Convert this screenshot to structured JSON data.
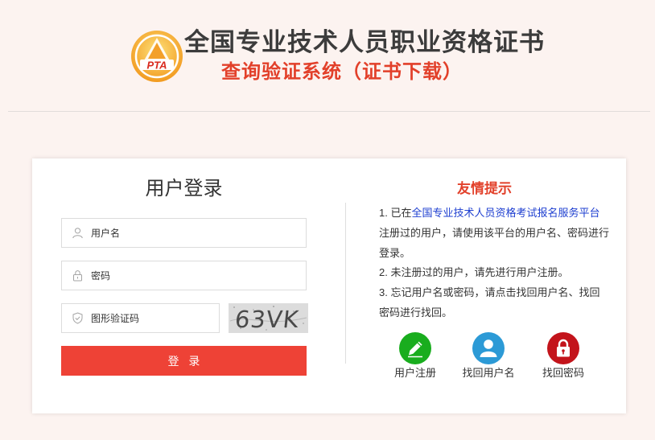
{
  "colors": {
    "page_bg": "#fcf3f0",
    "title": "#3c3c3c",
    "accent_red": "#e2402a",
    "button": "#ee4236",
    "link": "#1e3fd0"
  },
  "header": {
    "logo_text": "PTA",
    "title": "全国专业技术人员职业资格证书",
    "subtitle": "查询验证系统（证书下载）"
  },
  "login": {
    "title": "用户登录",
    "username": {
      "placeholder": "用户名",
      "value": "",
      "icon": "user-icon"
    },
    "password": {
      "placeholder": "密码",
      "value": "",
      "icon": "lock-icon"
    },
    "captcha": {
      "placeholder": "图形验证码",
      "value": "",
      "icon": "shield-check-icon",
      "image_text": "63VK"
    },
    "submit_label": "登 录"
  },
  "tips": {
    "title": "友情提示",
    "item1": {
      "prefix": "1. 已在",
      "link": "全国专业技术人员资格考试报名服务平台",
      "line2": "注册过的用户，请使用该平台的用户名、密码进行",
      "line3": "登录。"
    },
    "item2": {
      "line1": "2. 未注册过的用户，请先进行用户注册。"
    },
    "item3": {
      "line1": "3. 忘记用户名或密码，请点击找回用户名、找回",
      "line2": "密码进行找回。"
    }
  },
  "quick_links": [
    {
      "label": "用户注册",
      "icon": "pencil-icon",
      "color": "#19ad1e"
    },
    {
      "label": "找回用户名",
      "icon": "user-icon",
      "color": "#2c9ad6"
    },
    {
      "label": "找回密码",
      "icon": "lock-icon",
      "color": "#c3141b"
    }
  ]
}
